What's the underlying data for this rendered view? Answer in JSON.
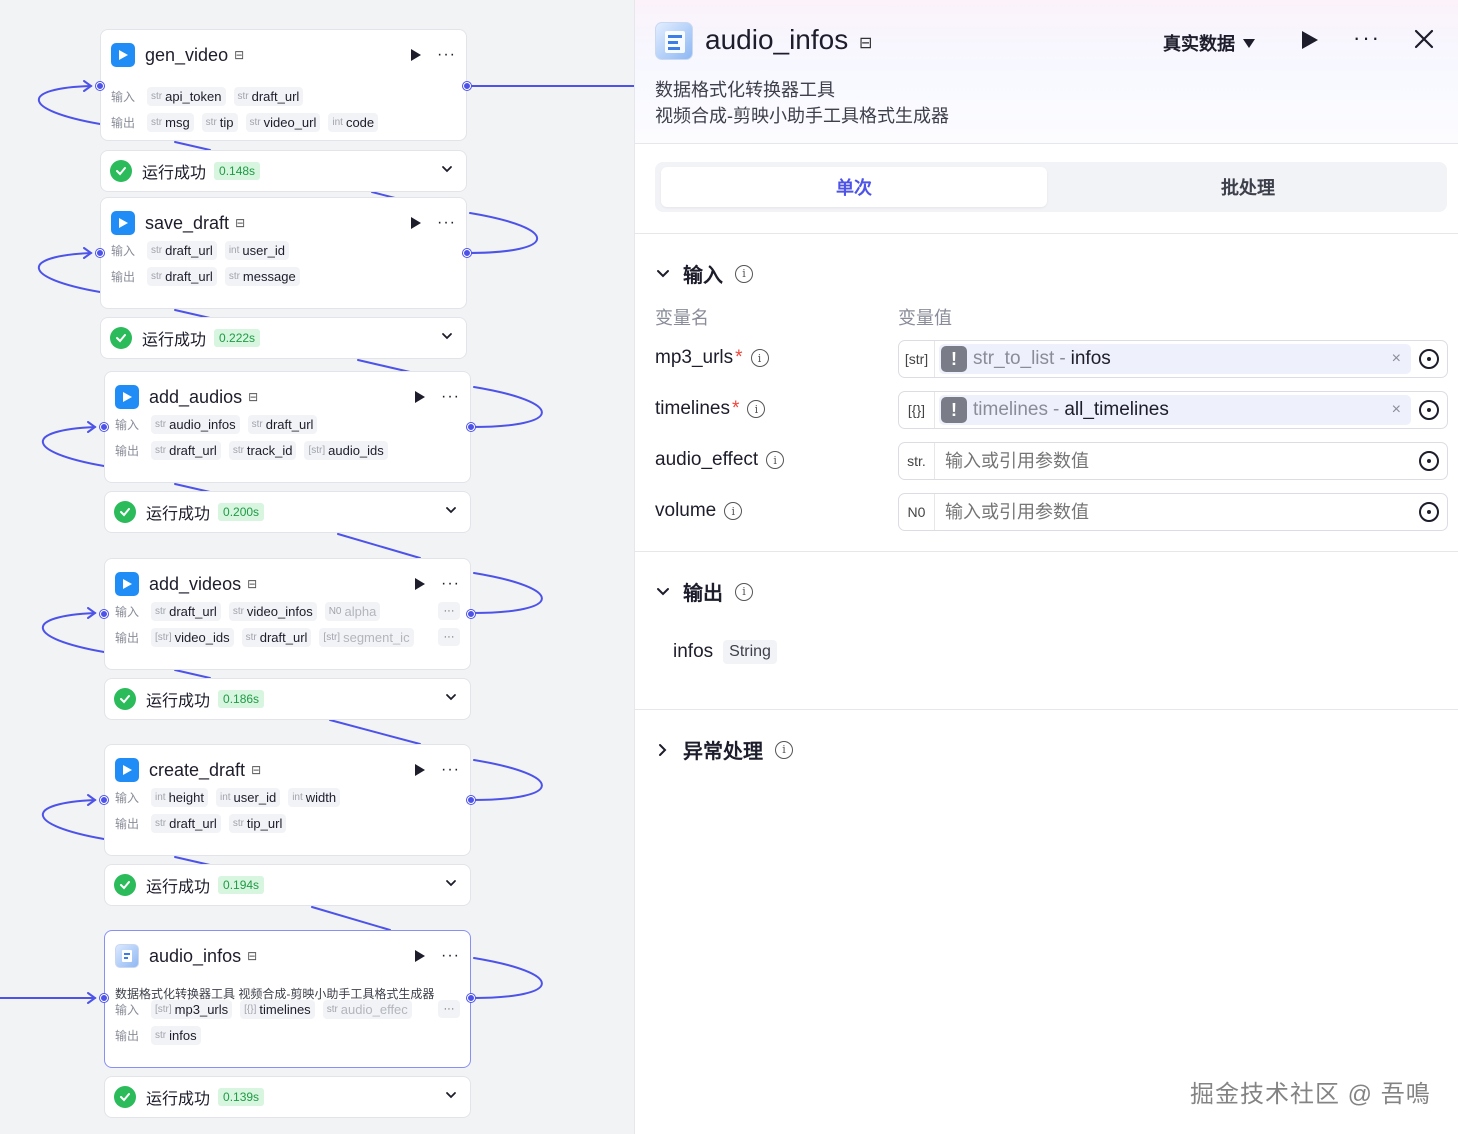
{
  "canvas": {
    "nodes": [
      {
        "title": "gen_video",
        "icon": "video-tool-icon",
        "input_label": "输入",
        "output_label": "输出",
        "inputs": [
          {
            "type": "str",
            "name": "api_token"
          },
          {
            "type": "str",
            "name": "draft_url"
          }
        ],
        "outputs": [
          {
            "type": "str",
            "name": "msg"
          },
          {
            "type": "str",
            "name": "tip"
          },
          {
            "type": "str",
            "name": "video_url"
          },
          {
            "type": "int",
            "name": "code"
          }
        ],
        "status": "运行成功",
        "time": "0.148s"
      },
      {
        "title": "save_draft",
        "icon": "video-tool-icon",
        "input_label": "输入",
        "output_label": "输出",
        "inputs": [
          {
            "type": "str",
            "name": "draft_url"
          },
          {
            "type": "int",
            "name": "user_id"
          }
        ],
        "outputs": [
          {
            "type": "str",
            "name": "draft_url"
          },
          {
            "type": "str",
            "name": "message"
          }
        ],
        "status": "运行成功",
        "time": "0.222s"
      },
      {
        "title": "add_audios",
        "icon": "video-tool-icon",
        "input_label": "输入",
        "output_label": "输出",
        "inputs": [
          {
            "type": "str",
            "name": "audio_infos"
          },
          {
            "type": "str",
            "name": "draft_url"
          }
        ],
        "outputs": [
          {
            "type": "str",
            "name": "draft_url"
          },
          {
            "type": "str",
            "name": "track_id"
          },
          {
            "type": "[str]",
            "name": "audio_ids"
          }
        ],
        "status": "运行成功",
        "time": "0.200s"
      },
      {
        "title": "add_videos",
        "icon": "video-tool-icon",
        "input_label": "输入",
        "output_label": "输出",
        "inputs": [
          {
            "type": "str",
            "name": "draft_url"
          },
          {
            "type": "str",
            "name": "video_infos"
          },
          {
            "type": "N0",
            "name": "alpha"
          }
        ],
        "outputs": [
          {
            "type": "[str]",
            "name": "video_ids"
          },
          {
            "type": "str",
            "name": "draft_url"
          },
          {
            "type": "[str]",
            "name": "segment_ic"
          }
        ],
        "status": "运行成功",
        "time": "0.186s"
      },
      {
        "title": "create_draft",
        "icon": "video-tool-icon",
        "input_label": "输入",
        "output_label": "输出",
        "inputs": [
          {
            "type": "int",
            "name": "height"
          },
          {
            "type": "int",
            "name": "user_id"
          },
          {
            "type": "int",
            "name": "width"
          }
        ],
        "outputs": [
          {
            "type": "str",
            "name": "draft_url"
          },
          {
            "type": "str",
            "name": "tip_url"
          }
        ],
        "status": "运行成功",
        "time": "0.194s"
      },
      {
        "title": "audio_infos",
        "icon": "format-tool-icon",
        "description": "数据格式化转换器工具 视频合成-剪映小助手工具格式生成器",
        "input_label": "输入",
        "output_label": "输出",
        "inputs": [
          {
            "type": "[str]",
            "name": "mp3_urls"
          },
          {
            "type": "[{}]",
            "name": "timelines"
          },
          {
            "type": "str",
            "name": "audio_effec"
          }
        ],
        "outputs": [
          {
            "type": "str",
            "name": "infos"
          }
        ],
        "status": "运行成功",
        "time": "0.139s"
      }
    ]
  },
  "panel": {
    "title": "audio_infos",
    "data_mode": "真实数据",
    "description_lines": [
      "数据格式化转换器工具",
      "视频合成-剪映小助手工具格式生成器"
    ],
    "tabs": {
      "single": "单次",
      "batch": "批处理"
    },
    "input_section": {
      "title": "输入",
      "col_name": "变量名",
      "col_value": "变量值",
      "params": [
        {
          "name": "mp3_urls",
          "required": "*",
          "type": "[str]",
          "ref_source": "str_to_list",
          "ref_sep": "-",
          "ref_key": "infos"
        },
        {
          "name": "timelines",
          "required": "*",
          "type": "[{}]",
          "ref_source": "timelines",
          "ref_sep": "-",
          "ref_key": "all_timelines"
        },
        {
          "name": "audio_effect",
          "type": "str.",
          "placeholder": "输入或引用参数值"
        },
        {
          "name": "volume",
          "type": "N0",
          "placeholder": "输入或引用参数值"
        }
      ]
    },
    "output_section": {
      "title": "输出",
      "outputs": [
        {
          "name": "infos",
          "type": "String"
        }
      ]
    },
    "exception_section": {
      "title": "异常处理"
    },
    "colors": {
      "accent": "#4d53e8",
      "success": "#2bbb5a",
      "success_bg": "#d7f5df"
    }
  },
  "watermark": "掘金技术社区 @ 吾鳴"
}
